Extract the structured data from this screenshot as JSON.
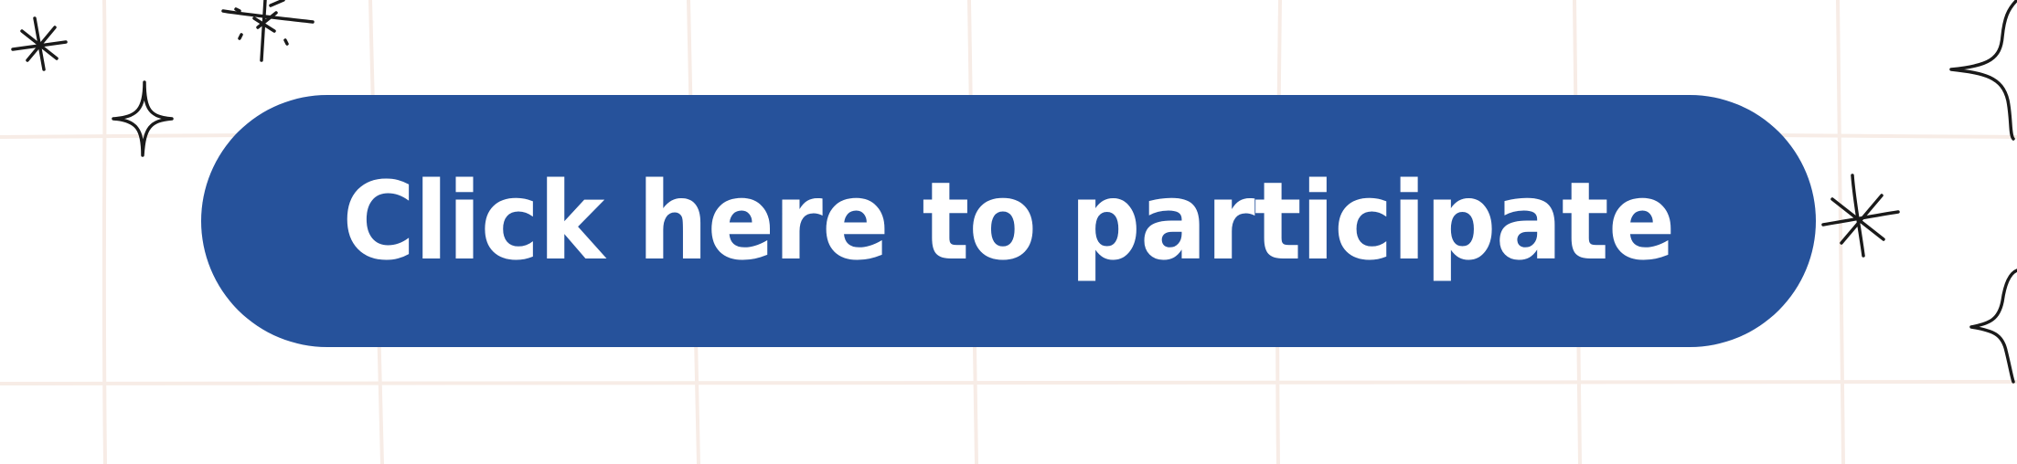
{
  "cta": {
    "label": "Click here to participate"
  },
  "colors": {
    "button_fill": "#26529b",
    "button_text": "#ffffff",
    "grid_line": "#f7ece6",
    "doodle_stroke": "#1a1a1a",
    "background": "#ffffff"
  },
  "decorations": {
    "icons": [
      "asterisk-doodle-icon",
      "sparkle-doodle-icon",
      "star-burst-doodle-icon"
    ]
  }
}
